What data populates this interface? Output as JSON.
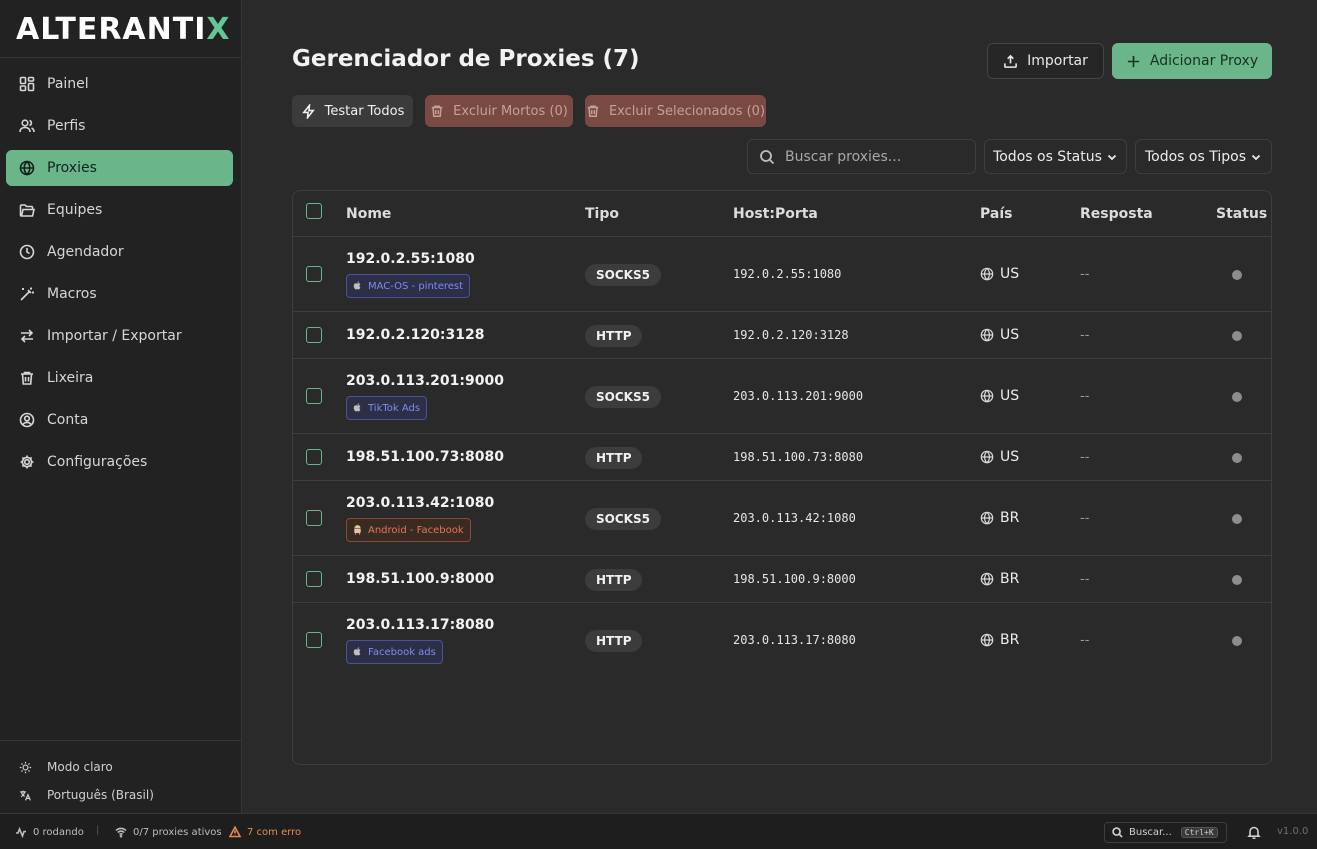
{
  "logo": {
    "main": "ALTERANTI",
    "accent": "X"
  },
  "sidebar": {
    "items": [
      {
        "label": "Painel",
        "icon": "dashboard-icon"
      },
      {
        "label": "Perfis",
        "icon": "users-icon"
      },
      {
        "label": "Proxies",
        "icon": "globe-icon",
        "active": true
      },
      {
        "label": "Equipes",
        "icon": "folder-icon"
      },
      {
        "label": "Agendador",
        "icon": "clock-icon"
      },
      {
        "label": "Macros",
        "icon": "magic-wand-icon"
      },
      {
        "label": "Importar / Exportar",
        "icon": "swap-arrows-icon"
      },
      {
        "label": "Lixeira",
        "icon": "trash-icon"
      },
      {
        "label": "Conta",
        "icon": "user-circle-icon"
      },
      {
        "label": "Configurações",
        "icon": "gear-icon"
      }
    ],
    "theme_label": "Modo claro",
    "language_label": "Português (Brasil)"
  },
  "header": {
    "title": "Gerenciador de Proxies (7)",
    "import_label": "Importar",
    "add_label": "Adicionar Proxy"
  },
  "actions": {
    "test_all": "Testar Todos",
    "delete_dead": "Excluir Mortos (0)",
    "delete_selected": "Excluir Selecionados (0)"
  },
  "filters": {
    "search_placeholder": "Buscar proxies...",
    "status_label": "Todos os Status",
    "type_label": "Todos os Tipos"
  },
  "table": {
    "columns": [
      "Nome",
      "Tipo",
      "Host:Porta",
      "País",
      "Resposta",
      "Status"
    ],
    "rows": [
      {
        "name": "192.0.2.55:1080",
        "tag": "MAC-OS - pinterest",
        "tag_kind": "apple",
        "type": "SOCKS5",
        "host": "192.0.2.55:1080",
        "country": "US",
        "response": "--"
      },
      {
        "name": "192.0.2.120:3128",
        "tag": "",
        "type": "HTTP",
        "host": "192.0.2.120:3128",
        "country": "US",
        "response": "--"
      },
      {
        "name": "203.0.113.201:9000",
        "tag": "TikTok Ads",
        "tag_kind": "apple",
        "type": "SOCKS5",
        "host": "203.0.113.201:9000",
        "country": "US",
        "response": "--"
      },
      {
        "name": "198.51.100.73:8080",
        "tag": "",
        "type": "HTTP",
        "host": "198.51.100.73:8080",
        "country": "US",
        "response": "--"
      },
      {
        "name": "203.0.113.42:1080",
        "tag": "Android - Facebook",
        "tag_kind": "android",
        "type": "SOCKS5",
        "host": "203.0.113.42:1080",
        "country": "BR",
        "response": "--"
      },
      {
        "name": "198.51.100.9:8000",
        "tag": "",
        "type": "HTTP",
        "host": "198.51.100.9:8000",
        "country": "BR",
        "response": "--"
      },
      {
        "name": "203.0.113.17:8080",
        "tag": "Facebook ads",
        "tag_kind": "apple",
        "type": "HTTP",
        "host": "203.0.113.17:8080",
        "country": "BR",
        "response": "--"
      }
    ]
  },
  "statusbar": {
    "running": "0 rodando",
    "active_proxies": "0/7 proxies ativos",
    "errors": "7 com erro",
    "search_label": "Buscar...",
    "shortcut": "Ctrl+K",
    "version": "v1.0.0"
  },
  "colors": {
    "accent": "#6ab68a",
    "danger_button": "#7a4a42",
    "error_text": "#e68a4f",
    "apple_tag": "#7d8cf0",
    "android_tag": "#e0784f"
  }
}
